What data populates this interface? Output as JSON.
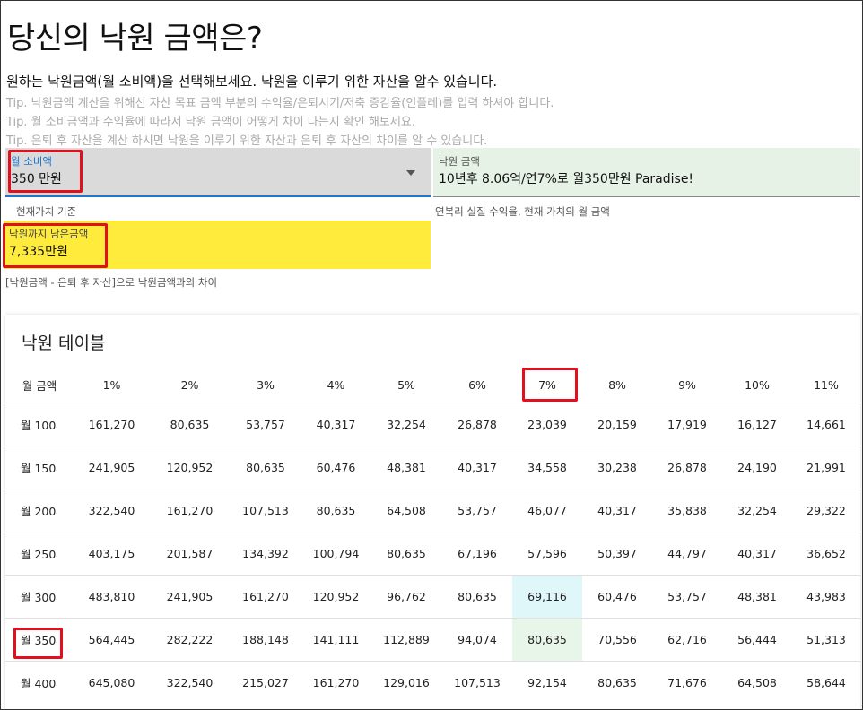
{
  "page": {
    "title": "당신의 낙원 금액은?",
    "intro": "원하는 낙원금액(월 소비액)을 선택해보세요. 낙원을 이루기 위한 자산을 알수 있습니다.",
    "tips": [
      "Tip. 낙원금액 계산을 위해선 자산 목표 금액 부분의 수익율/은퇴시기/저축 증감율(인플레)를 입력 하셔야 합니다.",
      "Tip. 월 소비금액과 수익율에 따라서 낙원 금액이 어떻게 차이 나는지 확인 해보세요.",
      "Tip. 은퇴 후 자산을 계산 하시면 낙원을 이루기 위한 자산과 은퇴 후 자산의 차이를 알 수 있습니다."
    ]
  },
  "monthly_select": {
    "label": "월 소비액",
    "value": "350 만원",
    "helper": "현재가치 기준"
  },
  "paradise_result": {
    "label": "낙원 금액",
    "value": "10년후 8.06억/연7%로 월350만원 Paradise!",
    "helper": "연복리 실질 수익율, 현재 가치의 월 금액"
  },
  "remaining": {
    "label": "낙원까지 남은금액",
    "value": "7,335만원",
    "helper": "[낙원금액 - 은퇴 후 자산]으로 낙원금액과의 차이"
  },
  "table": {
    "title": "낙원 테이블",
    "headers": [
      "월 금액",
      "1%",
      "2%",
      "3%",
      "4%",
      "5%",
      "6%",
      "7%",
      "8%",
      "9%",
      "10%",
      "11%"
    ],
    "rows": [
      [
        "월 100",
        "161,270",
        "80,635",
        "53,757",
        "40,317",
        "32,254",
        "26,878",
        "23,039",
        "20,159",
        "17,919",
        "16,127",
        "14,661"
      ],
      [
        "월 150",
        "241,905",
        "120,952",
        "80,635",
        "60,476",
        "48,381",
        "40,317",
        "34,558",
        "30,238",
        "26,878",
        "24,190",
        "21,991"
      ],
      [
        "월 200",
        "322,540",
        "161,270",
        "107,513",
        "80,635",
        "64,508",
        "53,757",
        "46,077",
        "40,317",
        "35,838",
        "32,254",
        "29,322"
      ],
      [
        "월 250",
        "403,175",
        "201,587",
        "134,392",
        "100,794",
        "80,635",
        "67,196",
        "57,596",
        "50,397",
        "44,797",
        "40,317",
        "36,652"
      ],
      [
        "월 300",
        "483,810",
        "241,905",
        "161,270",
        "120,952",
        "96,762",
        "80,635",
        "69,116",
        "60,476",
        "53,757",
        "48,381",
        "43,983"
      ],
      [
        "월 350",
        "564,445",
        "282,222",
        "188,148",
        "141,111",
        "112,889",
        "94,074",
        "80,635",
        "70,556",
        "62,716",
        "56,444",
        "51,313"
      ],
      [
        "월 400",
        "645,080",
        "322,540",
        "215,027",
        "161,270",
        "129,016",
        "107,513",
        "92,154",
        "80,635",
        "71,676",
        "64,508",
        "58,644"
      ]
    ]
  },
  "colors": {
    "accent": "#1976d2",
    "highlight": "#e0101f",
    "remaining_bg": "#ffeb3b",
    "result_bg": "#e6f2e6",
    "cell_blue": "#e0f7fa",
    "cell_green": "#e8f5e9"
  }
}
